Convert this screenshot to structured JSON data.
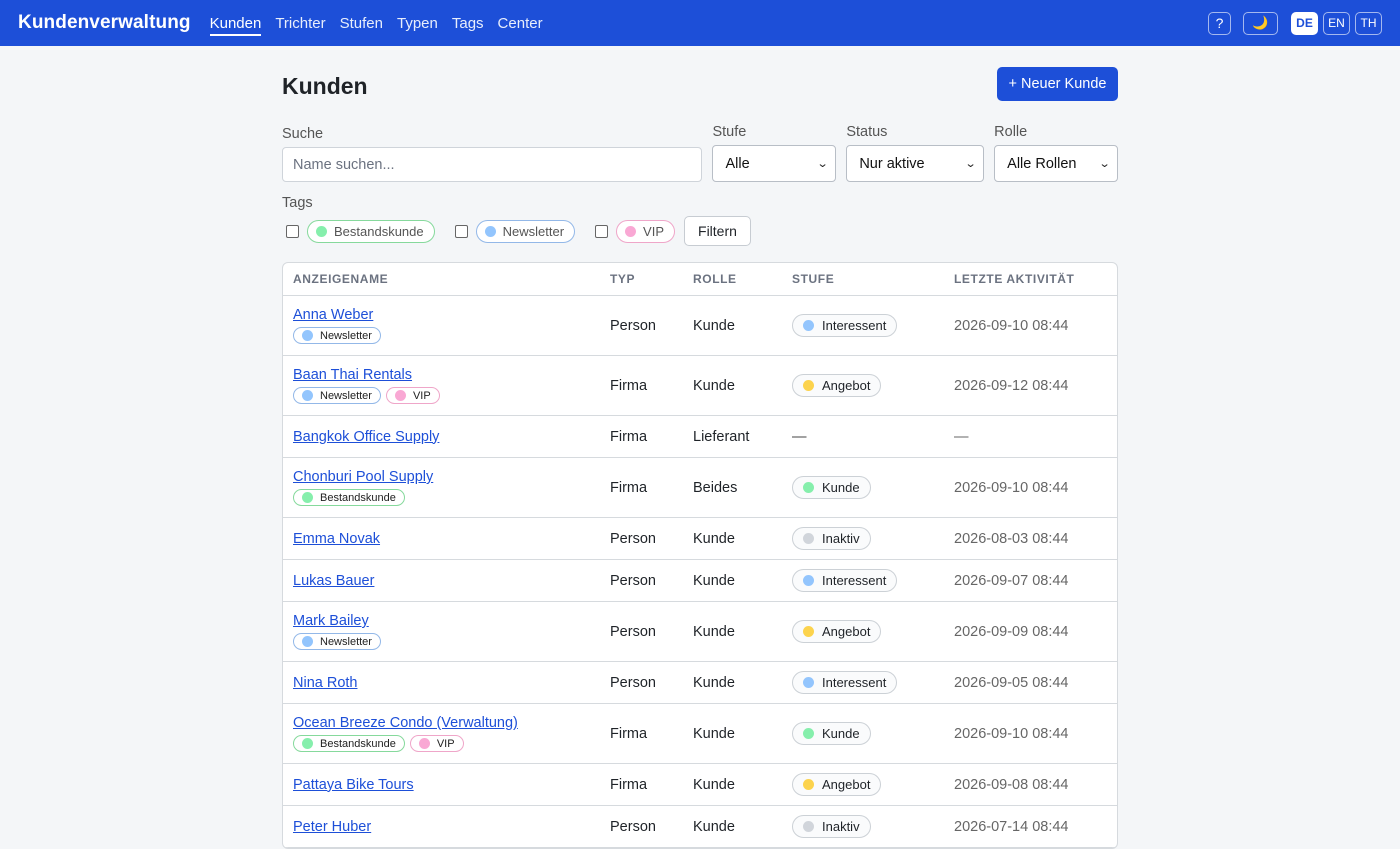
{
  "app": {
    "title": "Kundenverwaltung"
  },
  "nav": {
    "items": [
      {
        "label": "Kunden",
        "active": true
      },
      {
        "label": "Trichter"
      },
      {
        "label": "Stufen"
      },
      {
        "label": "Typen"
      },
      {
        "label": "Tags"
      },
      {
        "label": "Center"
      }
    ]
  },
  "topbar": {
    "help_label": "?",
    "theme_icon": "moon-icon",
    "theme_glyph": "🌙",
    "languages": [
      {
        "label": "DE",
        "active": true
      },
      {
        "label": "EN"
      },
      {
        "label": "TH"
      }
    ]
  },
  "page": {
    "title": "Kunden",
    "new_button": "+ Neuer Kunde"
  },
  "filters": {
    "search_label": "Suche",
    "search_placeholder": "Name suchen...",
    "stage_label": "Stufe",
    "stage_value": "Alle",
    "status_label": "Status",
    "status_value": "Nur aktive",
    "role_label": "Rolle",
    "role_value": "Alle Rollen",
    "tags_label": "Tags",
    "tags": [
      {
        "label": "Bestandskunde",
        "color": "#86efac",
        "border": "#86d99c"
      },
      {
        "label": "Newsletter",
        "color": "#93c5fd",
        "border": "#93b8e8"
      },
      {
        "label": "VIP",
        "color": "#f9a8d4",
        "border": "#efa6c9"
      }
    ],
    "filter_button": "Filtern"
  },
  "table": {
    "headers": [
      "ANZEIGENAME",
      "TYP",
      "ROLLE",
      "STUFE",
      "LETZTE AKTIVITÄT"
    ],
    "rows": [
      {
        "name": "Anna Weber",
        "tags": [
          "Newsletter"
        ],
        "type": "Person",
        "role": "Kunde",
        "stage": "Interessent",
        "last": "2026-09-10 08:44"
      },
      {
        "name": "Baan Thai Rentals",
        "tags": [
          "Newsletter",
          "VIP"
        ],
        "type": "Firma",
        "role": "Kunde",
        "stage": "Angebot",
        "last": "2026-09-12 08:44"
      },
      {
        "name": "Bangkok Office Supply",
        "tags": [],
        "type": "Firma",
        "role": "Lieferant",
        "stage": "—",
        "last": "—"
      },
      {
        "name": "Chonburi Pool Supply",
        "tags": [
          "Bestandskunde"
        ],
        "type": "Firma",
        "role": "Beides",
        "stage": "Kunde",
        "last": "2026-09-10 08:44"
      },
      {
        "name": "Emma Novak",
        "tags": [],
        "type": "Person",
        "role": "Kunde",
        "stage": "Inaktiv",
        "last": "2026-08-03 08:44"
      },
      {
        "name": "Lukas Bauer",
        "tags": [],
        "type": "Person",
        "role": "Kunde",
        "stage": "Interessent",
        "last": "2026-09-07 08:44"
      },
      {
        "name": "Mark Bailey",
        "tags": [
          "Newsletter"
        ],
        "type": "Person",
        "role": "Kunde",
        "stage": "Angebot",
        "last": "2026-09-09 08:44"
      },
      {
        "name": "Nina Roth",
        "tags": [],
        "type": "Person",
        "role": "Kunde",
        "stage": "Interessent",
        "last": "2026-09-05 08:44"
      },
      {
        "name": "Ocean Breeze Condo (Verwaltung)",
        "tags": [
          "Bestandskunde",
          "VIP"
        ],
        "type": "Firma",
        "role": "Kunde",
        "stage": "Kunde",
        "last": "2026-09-10 08:44"
      },
      {
        "name": "Pattaya Bike Tours",
        "tags": [],
        "type": "Firma",
        "role": "Kunde",
        "stage": "Angebot",
        "last": "2026-09-08 08:44"
      },
      {
        "name": "Peter Huber",
        "tags": [],
        "type": "Person",
        "role": "Kunde",
        "stage": "Inaktiv",
        "last": "2026-07-14 08:44"
      }
    ]
  },
  "colors": {
    "primary": "#1d4fd8",
    "tag_colors": {
      "Bestandskunde": "#86efac",
      "Newsletter": "#93c5fd",
      "VIP": "#f9a8d4"
    },
    "tag_borders": {
      "Bestandskunde": "#86d99c",
      "Newsletter": "#93b8e8",
      "VIP": "#efa6c9"
    },
    "stage_colors": {
      "Interessent": "#93c5fd",
      "Angebot": "#fcd34d",
      "Kunde": "#86efac",
      "Inaktiv": "#d1d5db"
    }
  }
}
